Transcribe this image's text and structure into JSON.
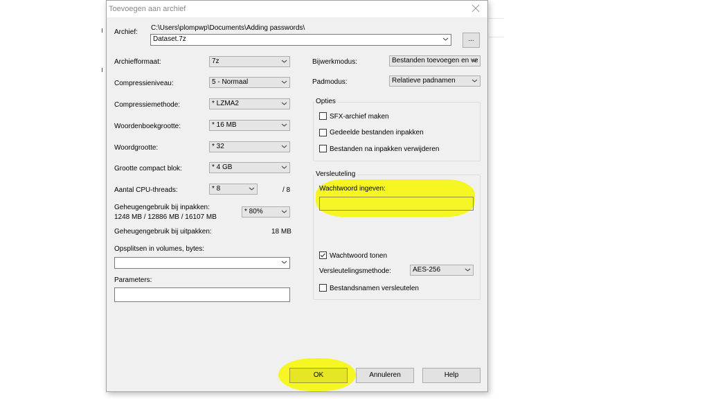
{
  "dialog": {
    "title": "Toevoegen aan archief",
    "archive_label": "Archief:",
    "archive_path": "C:\\Users\\plompwp\\Documents\\Adding passwords\\",
    "archive_name": "Dataset.7z",
    "browse_label": "..."
  },
  "left": {
    "format_label": "Archiefformaat:",
    "format_value": "7z",
    "level_label": "Compressieniveau:",
    "level_value": "5 - Normaal",
    "method_label": "Compressiemethode:",
    "method_value": "* LZMA2",
    "dict_label": "Woordenboekgrootte:",
    "dict_value": "* 16 MB",
    "word_label": "Woordgrootte:",
    "word_value": "* 32",
    "block_label": "Grootte compact blok:",
    "block_value": "* 4 GB",
    "threads_label": "Aantal CPU-threads:",
    "threads_value": "* 8",
    "threads_max": "/ 8",
    "mem_pack_label": "Geheugengebruik bij inpakken:",
    "mem_pack_detail": "1248 MB / 12886 MB / 16107 MB",
    "mem_pack_value": "* 80%",
    "mem_unpack_label": "Geheugengebruik bij uitpakken:",
    "mem_unpack_value": "18 MB",
    "split_label": "Opsplitsen in volumes, bytes:",
    "split_value": "",
    "params_label": "Parameters:",
    "params_value": ""
  },
  "right": {
    "update_label": "Bijwerkmodus:",
    "update_value": "Bestanden toevoegen en ve",
    "path_label": "Padmodus:",
    "path_value": "Relatieve padnamen",
    "options_title": "Opties",
    "opt_sfx": "SFX-archief maken",
    "opt_shared": "Gedeelde bestanden inpakken",
    "opt_delete": "Bestanden na inpakken verwijderen",
    "enc_title": "Versleuteling",
    "pw_label": "Wachtwoord ingeven:",
    "pw_value": "",
    "show_pw_label": "Wachtwoord tonen",
    "enc_method_label": "Versleutelingsmethode:",
    "enc_method_value": "AES-256",
    "enc_names_label": "Bestandsnamen versleutelen"
  },
  "buttons": {
    "ok": "OK",
    "cancel": "Annuleren",
    "help": "Help"
  },
  "colors": {
    "highlight": "#f7f700",
    "dialog_bg": "#f0f0f0"
  }
}
